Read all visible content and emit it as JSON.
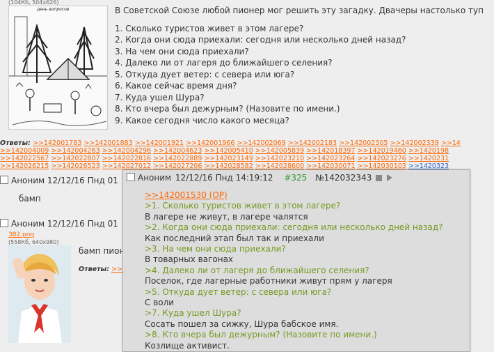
{
  "op": {
    "file_info": "(104Кб, 504x626)",
    "image_caption": "день вопросов",
    "intro": "В Советской Союзе любой пионер мог решить эту загадку. Двачеры настолько туп",
    "questions": [
      "1. Сколько туристов живет в этом лагере?",
      "2. Когда они сюда приехали: сегодня или несколько дней назад?",
      "3. На чем они сюда приехали?",
      "4. Далеко ли от лагеря до ближайшего селения?",
      "5. Откуда дует ветер: с севера или юга?",
      "6. Какое сейчас время дня?",
      "7. Куда ушел Шура?",
      "8. Кто вчера был дежурным? (Назовите по имени.)",
      "9. Какое сегодня число какого месяца?"
    ]
  },
  "replies": {
    "label": "Ответы:",
    "rows": [
      [
        ">>142001783",
        ">>142001883",
        ">>142001921",
        ">>142001966",
        ">>142002069",
        ">>142002183",
        ">>142002305",
        ">>142002339",
        ">>14"
      ],
      [
        ">>142004009",
        ">>142004263",
        ">>142004296",
        ">>142004623",
        ">>142005410",
        ">>142005839",
        ">>142018397",
        ">>142019460",
        ">>1420198"
      ],
      [
        ">>142022567",
        ">>142022807",
        ">>142022816",
        ">>142022889",
        ">>142023149",
        ">>142023210",
        ">>142023264",
        ">>142023276",
        ">>1420231"
      ],
      [
        ">>142026215",
        ">>142026523",
        ">>142027012",
        ">>142027206",
        ">>142028582",
        ">>142028600",
        ">>142030071",
        ">>142030103",
        ">>1420323"
      ]
    ]
  },
  "post1": {
    "header": "Аноним 12/12/16 Пнд 01",
    "text": "бамп"
  },
  "post2": {
    "header": "Аноним 12/12/16 Пнд 01",
    "file_link": "382.png",
    "file_info": "(558Кб, 640x980)",
    "text": "бамп пион",
    "replies_label": "Ответы:",
    "reply_link": ">>"
  },
  "popup": {
    "author": "Аноним",
    "date": "12/12/16 Пнд 14:19:12",
    "post_number": "#325",
    "post_id": "№142032343",
    "op_link": ">>142001530 (OP)",
    "lines": [
      {
        "type": "gt",
        "text": ">1. Сколько туристов живет в этом лагере?"
      },
      {
        "type": "plain",
        "text": "В лагере не живут, в лагере чалятся"
      },
      {
        "type": "gt",
        "text": ">2. Когда они сюда приехали: сегодня или несколько дней назад?"
      },
      {
        "type": "plain",
        "text": "Как последний этап был так и приехали"
      },
      {
        "type": "gt",
        "text": ">3. На чем они сюда приехали?"
      },
      {
        "type": "plain",
        "text": "В товарных вагонах"
      },
      {
        "type": "gt",
        "text": ">4. Далеко ли от лагеря до ближайшего селения?"
      },
      {
        "type": "plain",
        "text": "Поселок, где лагерные работники живут прям у лагеря"
      },
      {
        "type": "gt",
        "text": ">5. Откуда дует ветер: с севера или юга?"
      },
      {
        "type": "plain",
        "text": "С воли"
      },
      {
        "type": "gt",
        "text": ">7. Куда ушел Шура?"
      },
      {
        "type": "plain",
        "text": "Сосать пошел за сижку, Шура бабское имя."
      },
      {
        "type": "gt",
        "text": ">8. Кто вчера был дежурным? (Назовите по имени.)"
      },
      {
        "type": "plain",
        "text": "Козлище активист."
      }
    ]
  },
  "colors": {
    "link": "#ff6600",
    "greentext": "#789922",
    "post_number": "#339933",
    "highlight_link": "#3366cc"
  }
}
